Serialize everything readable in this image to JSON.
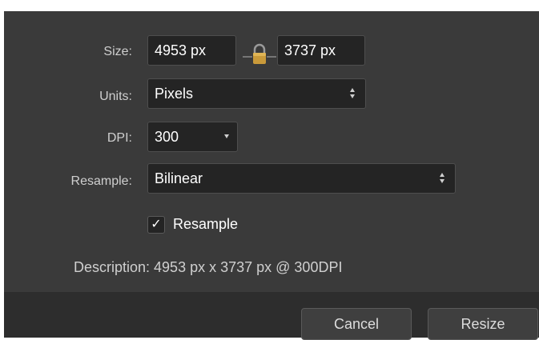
{
  "size": {
    "label": "Size:",
    "width_value": "4953 px",
    "height_value": "3737 px",
    "lock_icon": "padlock-icon",
    "lock_color": "#c99a3a"
  },
  "units": {
    "label": "Units:",
    "selected": "Pixels"
  },
  "dpi": {
    "label": "DPI:",
    "selected": "300"
  },
  "resample": {
    "label": "Resample:",
    "selected": "Bilinear",
    "checkbox_label": "Resample",
    "checkbox_mark": "✓",
    "checked": true
  },
  "description": "Description: 4953 px x 3737 px @ 300DPI",
  "buttons": {
    "cancel": "Cancel",
    "resize": "Resize"
  }
}
